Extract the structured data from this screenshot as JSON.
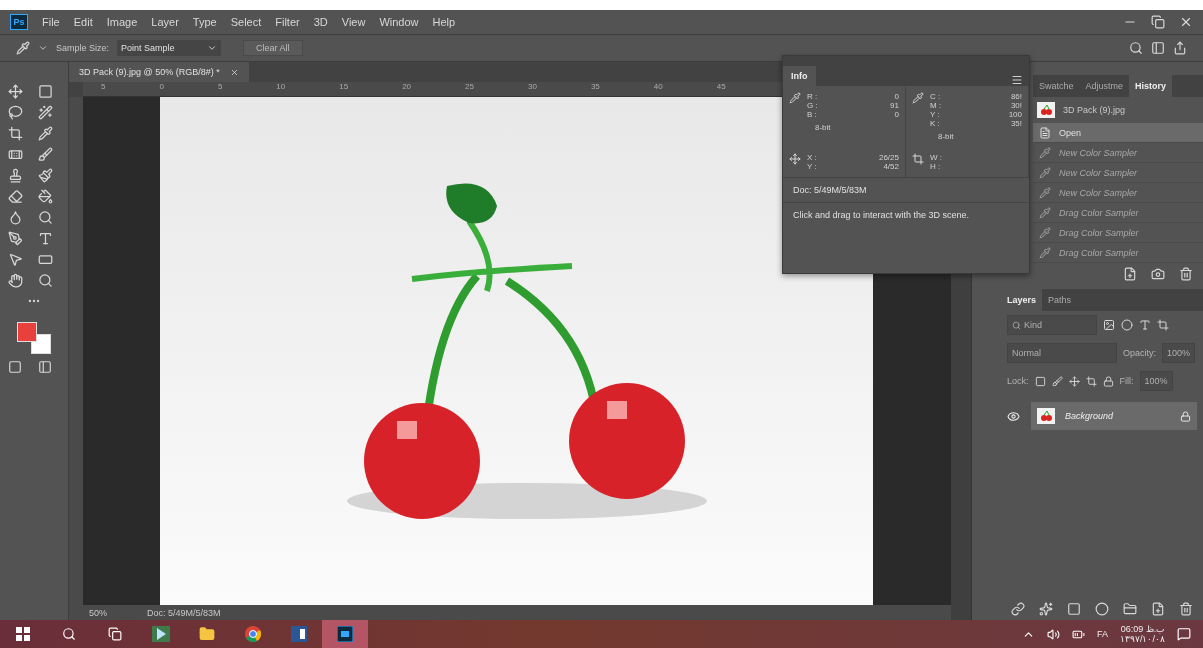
{
  "app_icon": "Ps",
  "menu": [
    "File",
    "Edit",
    "Image",
    "Layer",
    "Type",
    "Select",
    "Filter",
    "3D",
    "View",
    "Window",
    "Help"
  ],
  "options_bar": {
    "sample_size_label": "Sample Size:",
    "sample_size_value": "Point Sample",
    "clear_button": "Clear All"
  },
  "document": {
    "tab_title": "3D Pack (9).jpg @ 50% (RGB/8#) *",
    "ruler_labels": [
      "5",
      "0",
      "5",
      "10",
      "15",
      "20",
      "25",
      "30",
      "35",
      "40",
      "45"
    ],
    "zoom": "50%",
    "status": "Doc: 5/49M/5/83M"
  },
  "info_panel": {
    "tab": "Info",
    "rgb": [
      {
        "label": "R :",
        "value": "0"
      },
      {
        "label": "G :",
        "value": "91"
      },
      {
        "label": "B :",
        "value": "0"
      }
    ],
    "rgb_depth": "8-bit",
    "cmyk": [
      {
        "label": "C :",
        "value": "86!"
      },
      {
        "label": "M :",
        "value": "30!"
      },
      {
        "label": "Y :",
        "value": "100"
      },
      {
        "label": "K :",
        "value": "35!"
      }
    ],
    "cmyk_depth": "8-bit",
    "xy": [
      {
        "label": "X :",
        "value": "26/25"
      },
      {
        "label": "Y :",
        "value": "4/52"
      }
    ],
    "wh": [
      {
        "label": "W :"
      },
      {
        "label": "H :"
      }
    ],
    "doc": "Doc: 5/49M/5/83M",
    "hint": "Click and drag to interact with the 3D scene."
  },
  "history_panel": {
    "tabs": [
      {
        "label": "Swatche",
        "selected": false
      },
      {
        "label": "Adjustme",
        "selected": false
      },
      {
        "label": "History",
        "selected": true
      }
    ],
    "snapshot": "3D Pack (9).jpg",
    "items": [
      {
        "label": "Open",
        "kind": "document",
        "selected": true,
        "undone": false
      },
      {
        "label": "New Color Sampler",
        "kind": "sampler",
        "selected": false,
        "undone": true
      },
      {
        "label": "New Color Sampler",
        "kind": "sampler",
        "selected": false,
        "undone": true
      },
      {
        "label": "New Color Sampler",
        "kind": "sampler",
        "selected": false,
        "undone": true
      },
      {
        "label": "Drag Color Sampler",
        "kind": "sampler",
        "selected": false,
        "undone": true
      },
      {
        "label": "Drag Color Sampler",
        "kind": "sampler",
        "selected": false,
        "undone": true
      },
      {
        "label": "Drag Color Sampler",
        "kind": "sampler",
        "selected": false,
        "undone": true
      }
    ]
  },
  "layers_panel": {
    "tabs": [
      {
        "label": "Layers",
        "selected": true
      },
      {
        "label": "Paths",
        "selected": false
      }
    ],
    "filter_placeholder": "Kind",
    "blend_mode": "Normal",
    "opacity_label": "Opacity:",
    "opacity_value": "100%",
    "lock_label": "Lock:",
    "fill_label": "Fill:",
    "fill_value": "100%",
    "layers": [
      {
        "name": "Background",
        "visible": true,
        "locked": true
      }
    ]
  },
  "taskbar": {
    "apps": [
      {
        "kind": "start",
        "selected": false
      },
      {
        "kind": "search",
        "selected": false
      },
      {
        "kind": "taskview",
        "selected": false
      },
      {
        "kind": "media",
        "selected": false
      },
      {
        "kind": "folder",
        "selected": false
      },
      {
        "kind": "chrome",
        "selected": false
      },
      {
        "kind": "word",
        "selected": false
      },
      {
        "kind": "photoshop",
        "selected": true
      }
    ],
    "language": "FA",
    "time": "06:09 ب.ظ",
    "date": "۱۳۹۷/۱۰/۰۸"
  }
}
